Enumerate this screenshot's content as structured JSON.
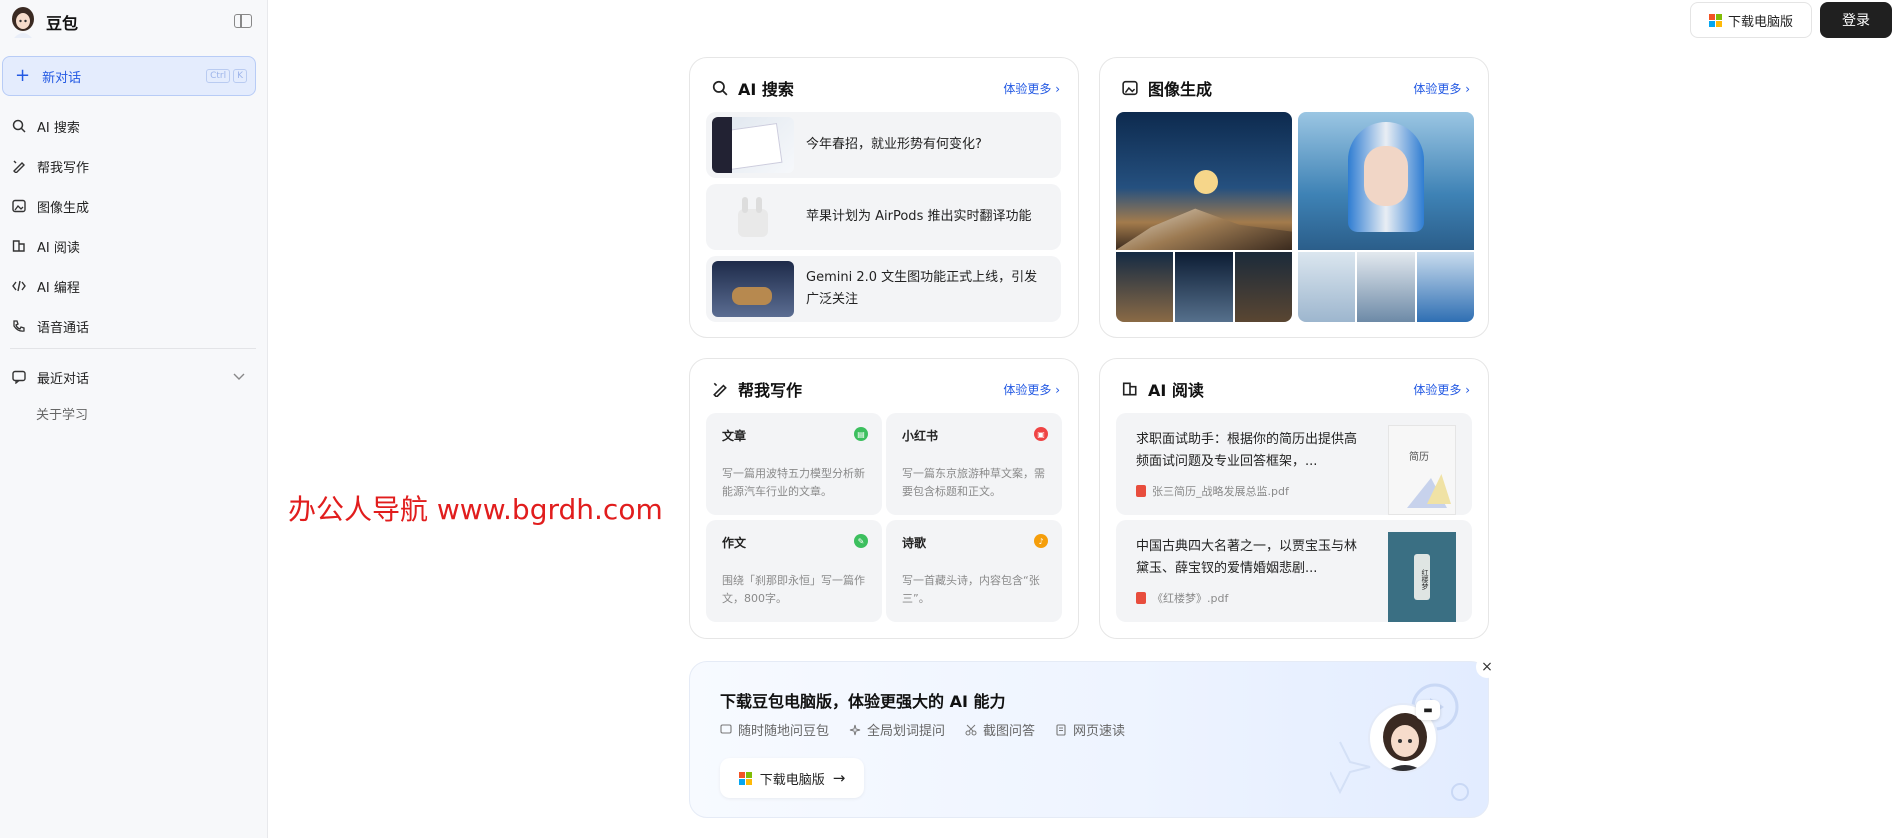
{
  "app": {
    "name": "豆包"
  },
  "sidebar": {
    "new_chat": "新对话",
    "shortcut": [
      "Ctrl",
      "K"
    ],
    "items": [
      {
        "label": "AI 搜索",
        "icon": "ai-search-icon"
      },
      {
        "label": "帮我写作",
        "icon": "pen-icon"
      },
      {
        "label": "图像生成",
        "icon": "image-icon"
      },
      {
        "label": "AI 阅读",
        "icon": "book-icon"
      },
      {
        "label": "AI 编程",
        "icon": "code-icon"
      },
      {
        "label": "语音通话",
        "icon": "phone-icon"
      }
    ],
    "recent_label": "最近对话",
    "history": [
      "关于学习"
    ]
  },
  "topbar": {
    "download": "下载电脑版",
    "login": "登录"
  },
  "cards": {
    "search": {
      "title": "AI 搜索",
      "more": "体验更多",
      "news": [
        "今年春招，就业形势有何变化?",
        "苹果计划为 AirPods 推出实时翻译功能",
        "Gemini 2.0 文生图功能正式上线，引发广泛关注"
      ]
    },
    "image": {
      "title": "图像生成",
      "more": "体验更多"
    },
    "write": {
      "title": "帮我写作",
      "more": "体验更多",
      "cells": [
        {
          "title": "文章",
          "desc": "写一篇用波特五力模型分析新能源汽车行业的文章。",
          "color": "#3cbf5e"
        },
        {
          "title": "小红书",
          "desc": "写一篇东京旅游种草文案，需要包含标题和正文。",
          "color": "#ef4444"
        },
        {
          "title": "作文",
          "desc": "围绕「刹那即永恒」写一篇作文，800字。",
          "color": "#3cbf5e"
        },
        {
          "title": "诗歌",
          "desc": "写一首藏头诗，内容包含“张三”。",
          "color": "#f59e0b"
        }
      ]
    },
    "read": {
      "title": "AI 阅读",
      "more": "体验更多",
      "items": [
        {
          "text": "求职面试助手：根据你的简历出提供高频面试问题及专业回答框架，...",
          "file": "张三简历_战略发展总监.pdf",
          "cover_text": "简历"
        },
        {
          "text": "中国古典四大名著之一，以贾宝玉与林黛玉、薛宝钗的爱情婚姻悲剧...",
          "file": "《红楼梦》.pdf",
          "cover_text": "红楼梦"
        }
      ]
    }
  },
  "banner": {
    "title": "下载豆包电脑版，体验更强大的 AI 能力",
    "features": [
      "随时随地问豆包",
      "全局划词提问",
      "截图问答",
      "网页速读"
    ],
    "button": "下载电脑版"
  },
  "watermark": "办公人导航 www.bgrdh.com",
  "colors": {
    "accent": "#2359e3",
    "watermark": "#e11d1d"
  }
}
